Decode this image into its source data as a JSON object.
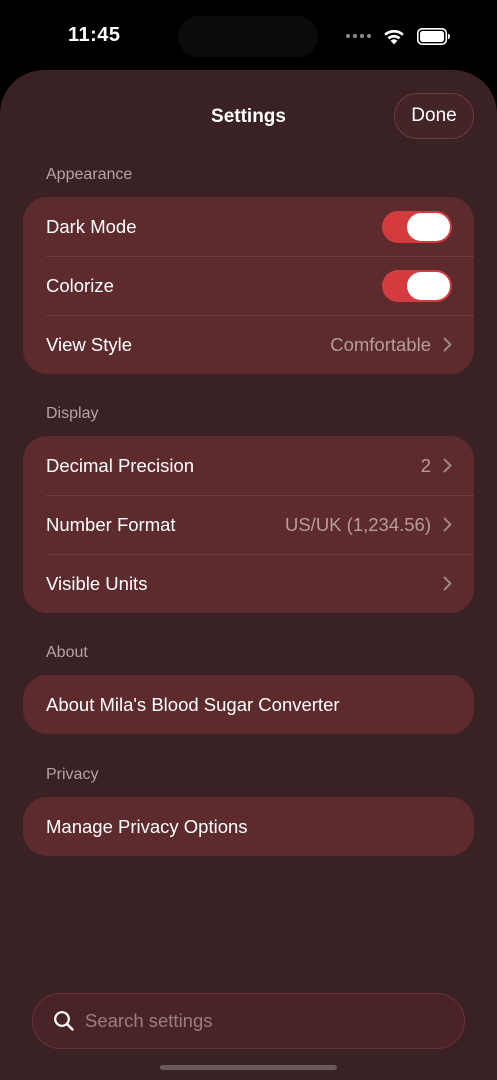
{
  "status_bar": {
    "time": "11:45"
  },
  "sheet": {
    "title": "Settings",
    "done_label": "Done"
  },
  "sections": {
    "appearance": {
      "header": "Appearance",
      "dark_mode": {
        "label": "Dark Mode",
        "on": true
      },
      "colorize": {
        "label": "Colorize",
        "on": true
      },
      "view_style": {
        "label": "View Style",
        "value": "Comfortable"
      }
    },
    "display": {
      "header": "Display",
      "decimal_precision": {
        "label": "Decimal Precision",
        "value": "2"
      },
      "number_format": {
        "label": "Number Format",
        "value": "US/UK (1,234.56)"
      },
      "visible_units": {
        "label": "Visible Units"
      }
    },
    "about": {
      "header": "About",
      "about_app": {
        "label": "About Mila's Blood Sugar Converter"
      }
    },
    "privacy": {
      "header": "Privacy",
      "manage_privacy": {
        "label": "Manage Privacy Options"
      }
    }
  },
  "search": {
    "placeholder": "Search settings"
  },
  "colors": {
    "sheet_background": "#3a2123",
    "group_background": "#5d2a2d",
    "toggle_on": "#d33b3e"
  }
}
